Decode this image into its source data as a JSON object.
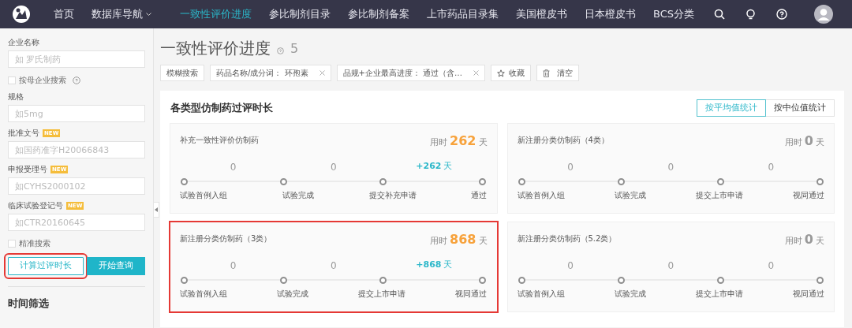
{
  "nav": {
    "items": [
      {
        "label": "首页",
        "selected": false,
        "dropdown": false
      },
      {
        "label": "数据库导航",
        "selected": false,
        "dropdown": true
      },
      {
        "label": "一致性评价进度",
        "selected": true,
        "dropdown": false
      },
      {
        "label": "参比制剂目录",
        "selected": false,
        "dropdown": false
      },
      {
        "label": "参比制剂备案",
        "selected": false,
        "dropdown": false
      },
      {
        "label": "上市药品目录集",
        "selected": false,
        "dropdown": false
      },
      {
        "label": "美国橙皮书",
        "selected": false,
        "dropdown": false
      },
      {
        "label": "日本橙皮书",
        "selected": false,
        "dropdown": false
      },
      {
        "label": "BCS分类",
        "selected": false,
        "dropdown": false
      }
    ]
  },
  "sidebar": {
    "fields": [
      {
        "kind": "input",
        "label": "企业名称",
        "placeholder": "如 罗氏制药"
      },
      {
        "kind": "checkbox",
        "label": "按母企业搜索",
        "checked": false,
        "help": true
      },
      {
        "kind": "input",
        "label": "规格",
        "placeholder": "如5mg"
      },
      {
        "kind": "input",
        "label": "批准文号",
        "badge": "NEW",
        "placeholder": "如国药准字H20066843"
      },
      {
        "kind": "input",
        "label": "申报受理号",
        "badge": "NEW",
        "placeholder": "如CYHS2000102"
      },
      {
        "kind": "input",
        "label": "临床试验登记号",
        "badge": "NEW",
        "placeholder": "如CTR20160645"
      },
      {
        "kind": "checkbox",
        "label": "精准搜索",
        "checked": false
      }
    ],
    "buttons": [
      {
        "label": "计算过评时长",
        "kind": "outline",
        "highlighted": true
      },
      {
        "label": "开始查询",
        "kind": "solid",
        "highlighted": false
      }
    ],
    "section_title": "时间筛选"
  },
  "main": {
    "title": "一致性评价进度",
    "count": "5",
    "filters": [
      {
        "kind": "plain",
        "label": "模糊搜索"
      },
      {
        "kind": "tag",
        "label": "药品名称/成分词： 环孢素"
      },
      {
        "kind": "tag",
        "label": "品规+企业最高进度： 通过（含…"
      },
      {
        "kind": "star",
        "label": "收藏"
      },
      {
        "kind": "trash",
        "label": "清空"
      }
    ],
    "panel": {
      "title": "各类型仿制药过评时长",
      "toggles": [
        {
          "label": "按平均值统计",
          "selected": true
        },
        {
          "label": "按中位值统计",
          "selected": false
        }
      ],
      "cards": [
        {
          "title": "补充一致性评价仿制药",
          "total_label": "用时",
          "total": "262",
          "unit": "天",
          "highlighted": false,
          "gaps": [
            {
              "kind": "zero",
              "text": "0"
            },
            {
              "kind": "zero",
              "text": "0"
            },
            {
              "kind": "plus",
              "text": "+262",
              "unit": "天"
            }
          ],
          "steps": [
            "试验首例入组",
            "试验完成",
            "提交补充申请",
            "通过"
          ]
        },
        {
          "title": "新注册分类仿制药（4类）",
          "total_label": "用时",
          "total": "0",
          "unit": "天",
          "highlighted": false,
          "gaps": [
            {
              "kind": "zero",
              "text": "0"
            },
            {
              "kind": "zero",
              "text": "0"
            },
            {
              "kind": "zero",
              "text": "0"
            }
          ],
          "steps": [
            "试验首例入组",
            "试验完成",
            "提交上市申请",
            "视同通过"
          ]
        },
        {
          "title": "新注册分类仿制药（3类）",
          "total_label": "用时",
          "total": "868",
          "unit": "天",
          "highlighted": true,
          "gaps": [
            {
              "kind": "zero",
              "text": "0"
            },
            {
              "kind": "zero",
              "text": "0"
            },
            {
              "kind": "plus",
              "text": "+868",
              "unit": "天"
            }
          ],
          "steps": [
            "试验首例入组",
            "试验完成",
            "提交上市申请",
            "视同通过"
          ]
        },
        {
          "title": "新注册分类仿制药（5.2类）",
          "total_label": "用时",
          "total": "0",
          "unit": "天",
          "highlighted": false,
          "gaps": [
            {
              "kind": "zero",
              "text": "0"
            },
            {
              "kind": "zero",
              "text": "0"
            },
            {
              "kind": "zero",
              "text": "0"
            }
          ],
          "steps": [
            "试验首例入组",
            "试验完成",
            "提交上市申请",
            "视同通过"
          ]
        }
      ]
    }
  }
}
